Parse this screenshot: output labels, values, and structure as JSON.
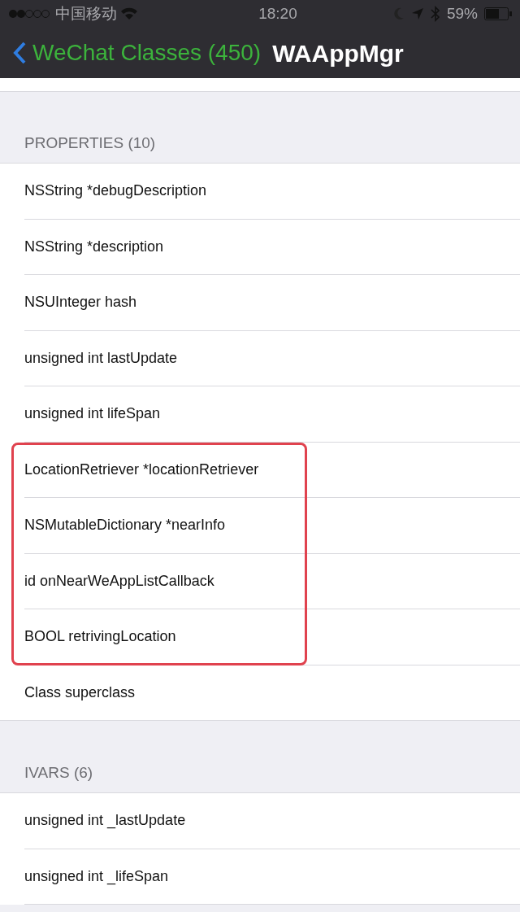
{
  "status_bar": {
    "carrier": "中国移动",
    "time": "18:20",
    "battery": "59%"
  },
  "nav": {
    "back": "WeChat Classes (450)",
    "title": "WAAppMgr"
  },
  "sections": [
    {
      "header": "PROPERTIES (10)",
      "rows": [
        {
          "text": "NSString *debugDescription",
          "highlighted": false
        },
        {
          "text": "NSString *description",
          "highlighted": false
        },
        {
          "text": "NSUInteger hash",
          "highlighted": false
        },
        {
          "text": "unsigned int lastUpdate",
          "highlighted": false
        },
        {
          "text": "unsigned int lifeSpan",
          "highlighted": false
        },
        {
          "text": "LocationRetriever *locationRetriever",
          "highlighted": true
        },
        {
          "text": "NSMutableDictionary *nearInfo",
          "highlighted": true
        },
        {
          "text": "id onNearWeAppListCallback",
          "highlighted": true
        },
        {
          "text": "BOOL retrivingLocation",
          "highlighted": true
        },
        {
          "text": "Class superclass",
          "highlighted": false
        }
      ]
    },
    {
      "header": "IVARS (6)",
      "rows": [
        {
          "text": "unsigned int _lastUpdate",
          "highlighted": false
        },
        {
          "text": "unsigned int _lifeSpan",
          "highlighted": false
        }
      ]
    }
  ]
}
